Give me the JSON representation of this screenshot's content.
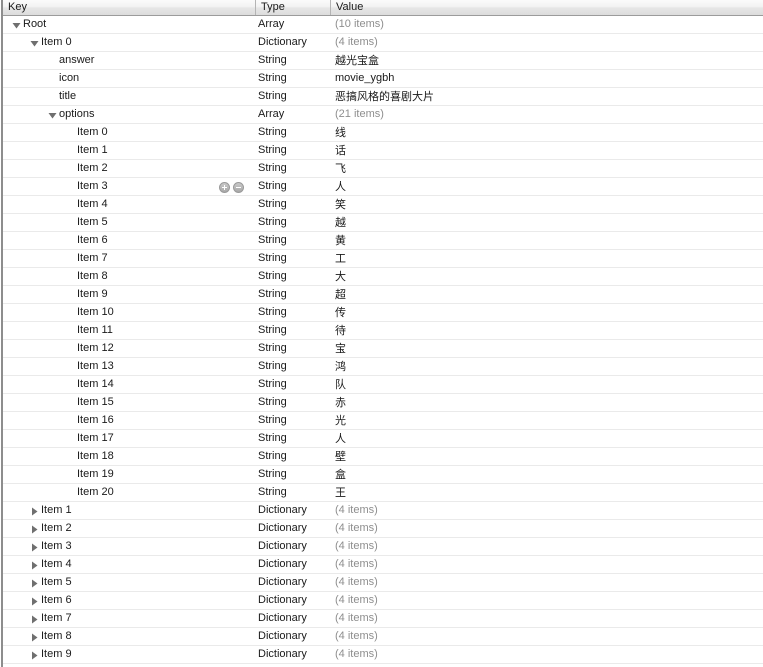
{
  "colors": {
    "header_bg": "#e9e9e9",
    "header_border": "#9b9b9b",
    "row_sep": "#eaeaea",
    "muted_text": "#8e8e8e",
    "text": "#1a1a1a"
  },
  "header": {
    "columns": [
      {
        "label": "Key"
      },
      {
        "label": "Type"
      },
      {
        "label": "Value"
      }
    ]
  },
  "types": {
    "array": "Array",
    "dictionary": "Dictionary",
    "string": "String"
  },
  "rows": [
    {
      "indent": 0,
      "twisty": "expanded",
      "key": "Root",
      "type": "Array",
      "value": "(10 items)",
      "muted": true,
      "controls": false
    },
    {
      "indent": 1,
      "twisty": "expanded",
      "key": "Item 0",
      "type": "Dictionary",
      "value": "(4 items)",
      "muted": true,
      "controls": false
    },
    {
      "indent": 2,
      "twisty": "none",
      "key": "answer",
      "type": "String",
      "value": "越光宝盒",
      "muted": false,
      "controls": false
    },
    {
      "indent": 2,
      "twisty": "none",
      "key": "icon",
      "type": "String",
      "value": "movie_ygbh",
      "muted": false,
      "controls": false
    },
    {
      "indent": 2,
      "twisty": "none",
      "key": "title",
      "type": "String",
      "value": "恶搞风格的喜剧大片",
      "muted": false,
      "controls": false
    },
    {
      "indent": 2,
      "twisty": "expanded",
      "key": "options",
      "type": "Array",
      "value": "(21 items)",
      "muted": true,
      "controls": false
    },
    {
      "indent": 3,
      "twisty": "none",
      "key": "Item 0",
      "type": "String",
      "value": "线",
      "muted": false,
      "controls": false
    },
    {
      "indent": 3,
      "twisty": "none",
      "key": "Item 1",
      "type": "String",
      "value": "话",
      "muted": false,
      "controls": false
    },
    {
      "indent": 3,
      "twisty": "none",
      "key": "Item 2",
      "type": "String",
      "value": "飞",
      "muted": false,
      "controls": false
    },
    {
      "indent": 3,
      "twisty": "none",
      "key": "Item 3",
      "type": "String",
      "value": "人",
      "muted": false,
      "controls": true
    },
    {
      "indent": 3,
      "twisty": "none",
      "key": "Item 4",
      "type": "String",
      "value": "笑",
      "muted": false,
      "controls": false
    },
    {
      "indent": 3,
      "twisty": "none",
      "key": "Item 5",
      "type": "String",
      "value": "越",
      "muted": false,
      "controls": false
    },
    {
      "indent": 3,
      "twisty": "none",
      "key": "Item 6",
      "type": "String",
      "value": "黄",
      "muted": false,
      "controls": false
    },
    {
      "indent": 3,
      "twisty": "none",
      "key": "Item 7",
      "type": "String",
      "value": "工",
      "muted": false,
      "controls": false
    },
    {
      "indent": 3,
      "twisty": "none",
      "key": "Item 8",
      "type": "String",
      "value": "大",
      "muted": false,
      "controls": false
    },
    {
      "indent": 3,
      "twisty": "none",
      "key": "Item 9",
      "type": "String",
      "value": "超",
      "muted": false,
      "controls": false
    },
    {
      "indent": 3,
      "twisty": "none",
      "key": "Item 10",
      "type": "String",
      "value": "传",
      "muted": false,
      "controls": false
    },
    {
      "indent": 3,
      "twisty": "none",
      "key": "Item 11",
      "type": "String",
      "value": "待",
      "muted": false,
      "controls": false
    },
    {
      "indent": 3,
      "twisty": "none",
      "key": "Item 12",
      "type": "String",
      "value": "宝",
      "muted": false,
      "controls": false
    },
    {
      "indent": 3,
      "twisty": "none",
      "key": "Item 13",
      "type": "String",
      "value": "鸿",
      "muted": false,
      "controls": false
    },
    {
      "indent": 3,
      "twisty": "none",
      "key": "Item 14",
      "type": "String",
      "value": "队",
      "muted": false,
      "controls": false
    },
    {
      "indent": 3,
      "twisty": "none",
      "key": "Item 15",
      "type": "String",
      "value": "赤",
      "muted": false,
      "controls": false
    },
    {
      "indent": 3,
      "twisty": "none",
      "key": "Item 16",
      "type": "String",
      "value": "光",
      "muted": false,
      "controls": false
    },
    {
      "indent": 3,
      "twisty": "none",
      "key": "Item 17",
      "type": "String",
      "value": "人",
      "muted": false,
      "controls": false
    },
    {
      "indent": 3,
      "twisty": "none",
      "key": "Item 18",
      "type": "String",
      "value": "壁",
      "muted": false,
      "controls": false
    },
    {
      "indent": 3,
      "twisty": "none",
      "key": "Item 19",
      "type": "String",
      "value": "盒",
      "muted": false,
      "controls": false
    },
    {
      "indent": 3,
      "twisty": "none",
      "key": "Item 20",
      "type": "String",
      "value": "王",
      "muted": false,
      "controls": false
    },
    {
      "indent": 1,
      "twisty": "collapsed",
      "key": "Item 1",
      "type": "Dictionary",
      "value": "(4 items)",
      "muted": true,
      "controls": false
    },
    {
      "indent": 1,
      "twisty": "collapsed",
      "key": "Item 2",
      "type": "Dictionary",
      "value": "(4 items)",
      "muted": true,
      "controls": false
    },
    {
      "indent": 1,
      "twisty": "collapsed",
      "key": "Item 3",
      "type": "Dictionary",
      "value": "(4 items)",
      "muted": true,
      "controls": false
    },
    {
      "indent": 1,
      "twisty": "collapsed",
      "key": "Item 4",
      "type": "Dictionary",
      "value": "(4 items)",
      "muted": true,
      "controls": false
    },
    {
      "indent": 1,
      "twisty": "collapsed",
      "key": "Item 5",
      "type": "Dictionary",
      "value": "(4 items)",
      "muted": true,
      "controls": false
    },
    {
      "indent": 1,
      "twisty": "collapsed",
      "key": "Item 6",
      "type": "Dictionary",
      "value": "(4 items)",
      "muted": true,
      "controls": false
    },
    {
      "indent": 1,
      "twisty": "collapsed",
      "key": "Item 7",
      "type": "Dictionary",
      "value": "(4 items)",
      "muted": true,
      "controls": false
    },
    {
      "indent": 1,
      "twisty": "collapsed",
      "key": "Item 8",
      "type": "Dictionary",
      "value": "(4 items)",
      "muted": true,
      "controls": false
    },
    {
      "indent": 1,
      "twisty": "collapsed",
      "key": "Item 9",
      "type": "Dictionary",
      "value": "(4 items)",
      "muted": true,
      "controls": false
    }
  ],
  "row_controls": {
    "add_label": "+",
    "remove_label": "-"
  }
}
